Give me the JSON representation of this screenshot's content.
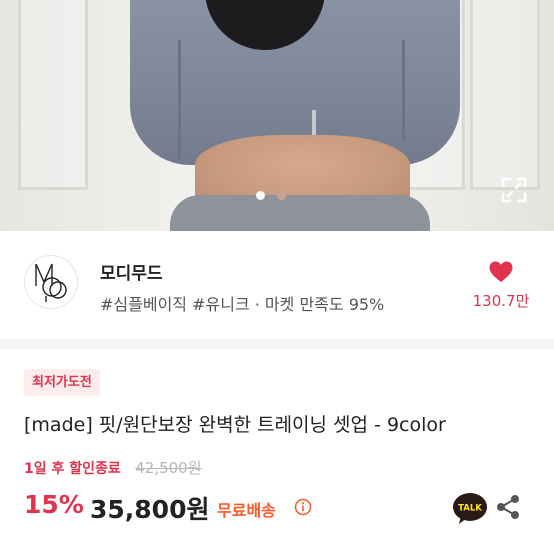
{
  "carousel": {
    "active_index": 1,
    "total": 2
  },
  "seller": {
    "name": "모디무드",
    "tags": "#심플베이직 #유니크 · 마켓 만족도 95%",
    "likes": "130.7만"
  },
  "product": {
    "badge": "최저가도전",
    "title": "[made] 핏/원단보장 완벽한 트레이닝 셋업 - 9color",
    "sale_timer": "1일 후 할인종료",
    "original_price": "42,500원",
    "discount": "15%",
    "price": "35,800원",
    "shipping": "무료배송",
    "talk_label": "TALK"
  },
  "colors": {
    "accent": "#e0334e",
    "shipping": "#ff5a2a",
    "kakao": "#2b1a14"
  },
  "icons": {
    "expand": "expand-icon",
    "heart": "heart-icon",
    "info": "info-icon",
    "talk": "kakaotalk-icon",
    "share": "share-icon"
  }
}
